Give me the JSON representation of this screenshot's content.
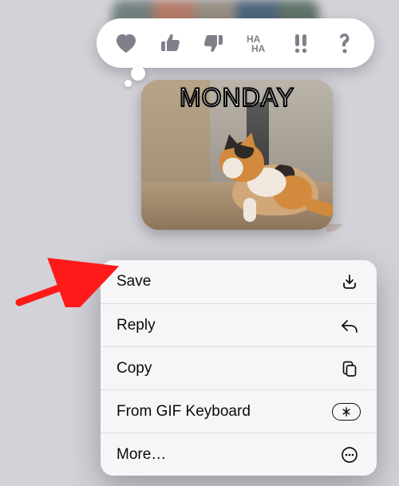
{
  "reactions": {
    "items": [
      {
        "name": "heart",
        "aria": "Love"
      },
      {
        "name": "thumbs-up",
        "aria": "Like"
      },
      {
        "name": "thumbs-down",
        "aria": "Dislike"
      },
      {
        "name": "haha",
        "aria": "Ha Ha"
      },
      {
        "name": "exclaim",
        "aria": "Emphasize"
      },
      {
        "name": "question",
        "aria": "Question"
      }
    ]
  },
  "message": {
    "gif_caption": "MONDAY"
  },
  "context_menu": {
    "items": [
      {
        "label": "Save",
        "icon": "download-icon"
      },
      {
        "label": "Reply",
        "icon": "reply-icon"
      },
      {
        "label": "Copy",
        "icon": "copy-icon"
      },
      {
        "label": "From GIF Keyboard",
        "icon": "appstore-pill-icon"
      },
      {
        "label": "More…",
        "icon": "more-icon"
      }
    ]
  },
  "annotation": {
    "target": "context_menu.items.0"
  },
  "colors": {
    "menu_bg": "#f7f7fa",
    "divider": "rgba(0,0,0,.10)",
    "reaction_inactive": "#80808a",
    "arrow": "#ff1a1a"
  }
}
